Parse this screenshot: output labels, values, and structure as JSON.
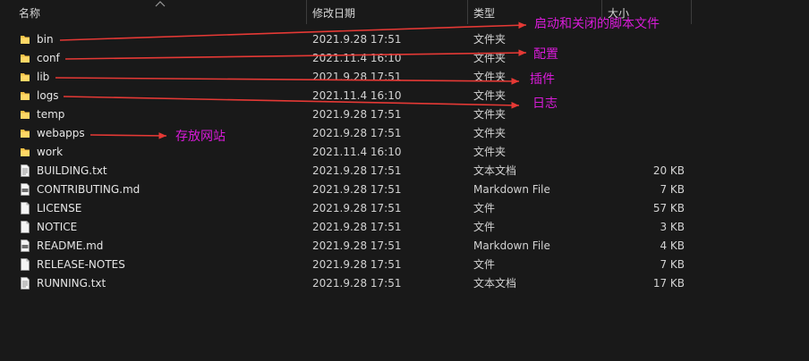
{
  "header": {
    "name": "名称",
    "date": "修改日期",
    "type": "类型",
    "size": "大小"
  },
  "files": [
    {
      "name": "bin",
      "date": "2021.9.28 17:51",
      "type": "文件夹",
      "size": "",
      "icon": "folder-icon"
    },
    {
      "name": "conf",
      "date": "2021.11.4 16:10",
      "type": "文件夹",
      "size": "",
      "icon": "folder-icon"
    },
    {
      "name": "lib",
      "date": "2021.9.28 17:51",
      "type": "文件夹",
      "size": "",
      "icon": "folder-icon"
    },
    {
      "name": "logs",
      "date": "2021.11.4 16:10",
      "type": "文件夹",
      "size": "",
      "icon": "folder-icon"
    },
    {
      "name": "temp",
      "date": "2021.9.28 17:51",
      "type": "文件夹",
      "size": "",
      "icon": "folder-icon"
    },
    {
      "name": "webapps",
      "date": "2021.9.28 17:51",
      "type": "文件夹",
      "size": "",
      "icon": "folder-icon"
    },
    {
      "name": "work",
      "date": "2021.11.4 16:10",
      "type": "文件夹",
      "size": "",
      "icon": "folder-icon"
    },
    {
      "name": "BUILDING.txt",
      "date": "2021.9.28 17:51",
      "type": "文本文档",
      "size": "20 KB",
      "icon": "text-file-icon"
    },
    {
      "name": "CONTRIBUTING.md",
      "date": "2021.9.28 17:51",
      "type": "Markdown File",
      "size": "7 KB",
      "icon": "markdown-file-icon"
    },
    {
      "name": "LICENSE",
      "date": "2021.9.28 17:51",
      "type": "文件",
      "size": "57 KB",
      "icon": "file-icon"
    },
    {
      "name": "NOTICE",
      "date": "2021.9.28 17:51",
      "type": "文件",
      "size": "3 KB",
      "icon": "file-icon"
    },
    {
      "name": "README.md",
      "date": "2021.9.28 17:51",
      "type": "Markdown File",
      "size": "4 KB",
      "icon": "markdown-file-icon"
    },
    {
      "name": "RELEASE-NOTES",
      "date": "2021.9.28 17:51",
      "type": "文件",
      "size": "7 KB",
      "icon": "file-icon"
    },
    {
      "name": "RUNNING.txt",
      "date": "2021.9.28 17:51",
      "type": "文本文档",
      "size": "17 KB",
      "icon": "text-file-icon"
    }
  ],
  "annotations": {
    "bin": "启动和关闭的脚本文件",
    "conf": "配置",
    "lib": "插件",
    "logs": "日志",
    "webapps": "存放网站"
  },
  "colors": {
    "background": "#191919",
    "annotation_text": "#d81bd8",
    "arrow": "#e53935",
    "folder": "#f5c146"
  }
}
